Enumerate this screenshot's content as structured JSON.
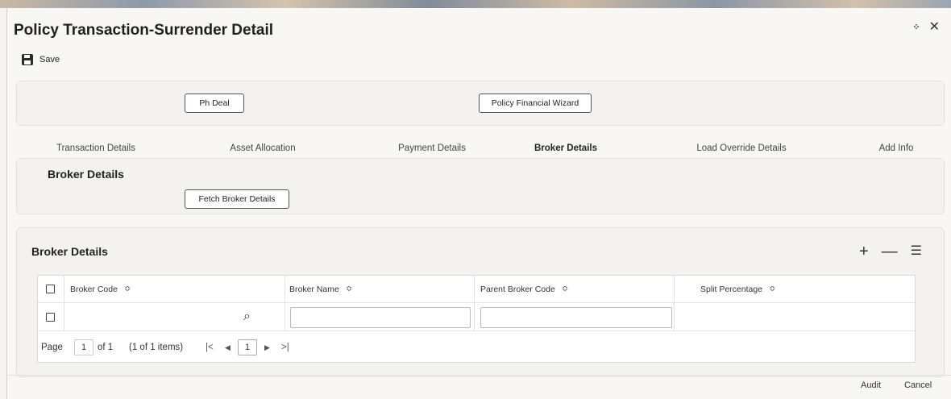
{
  "window": {
    "title": "Policy Transaction-Surrender Detail"
  },
  "toolbar": {
    "save_label": "Save"
  },
  "buttons": {
    "ph_deal": "Ph Deal",
    "policy_financial_wizard": "Policy Financial Wizard",
    "fetch_broker_details": "Fetch Broker Details"
  },
  "tabs": [
    {
      "label": "Transaction Details"
    },
    {
      "label": "Asset Allocation"
    },
    {
      "label": "Payment Details"
    },
    {
      "label": "Broker Details",
      "active": true
    },
    {
      "label": "Load Override Details"
    },
    {
      "label": "Add Info"
    }
  ],
  "broker_section": {
    "title": "Broker Details"
  },
  "grid": {
    "title": "Broker Details",
    "columns": [
      "Broker Code",
      "Broker Name",
      "Parent Broker Code",
      "Split Percentage"
    ],
    "rows": [
      {
        "broker_code": "",
        "broker_name": "",
        "parent_broker_code": "",
        "split_percentage": ""
      }
    ],
    "pager": {
      "page_label": "Page",
      "page_value": "1",
      "of_label": "of 1",
      "items_label": "(1 of 1 items)",
      "current_page": "1"
    }
  },
  "icons": {
    "save": "save-icon",
    "collapse": "collapse-icon",
    "close": "close-icon",
    "search": "search-icon",
    "add": "plus-icon",
    "remove": "minus-icon",
    "columns": "list-settings-icon"
  },
  "footer": {
    "audit_label": "Audit",
    "cancel_label": "Cancel"
  },
  "colors": {
    "active_tab_underline": "#3b5c86",
    "background": "#f8f7f4"
  }
}
